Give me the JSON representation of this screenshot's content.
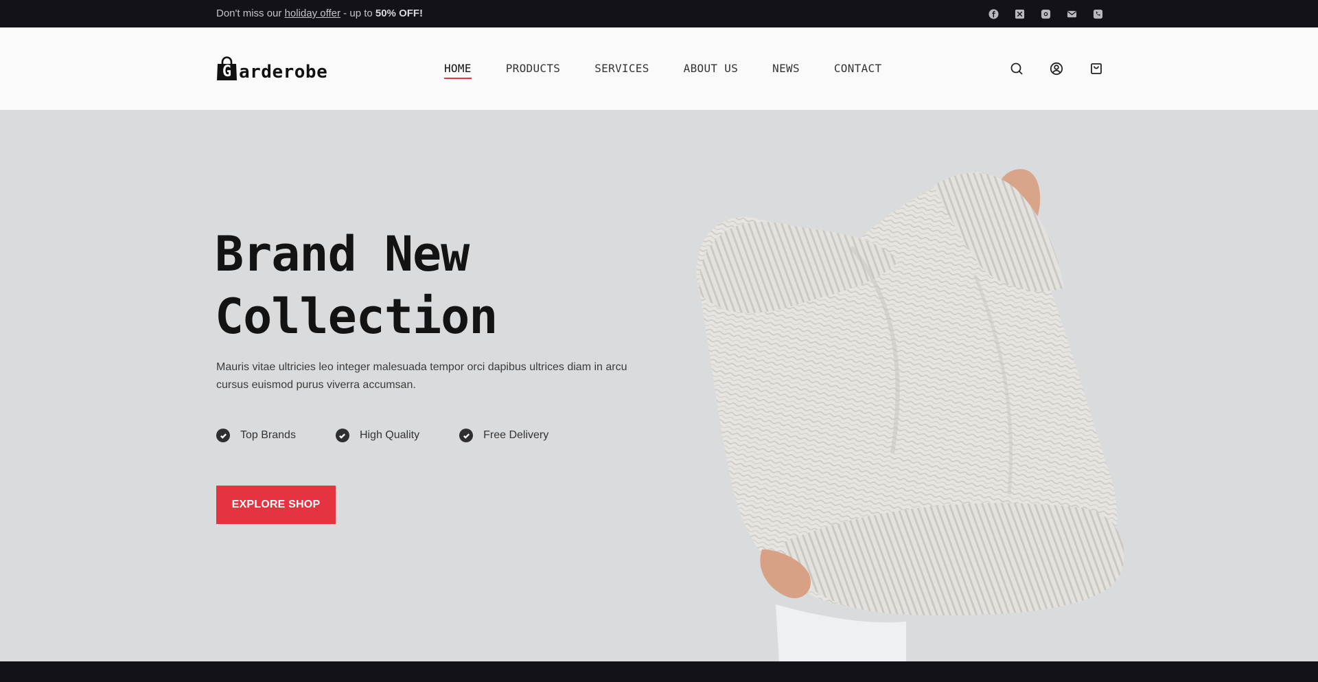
{
  "topbar": {
    "promo_prefix": "Don't miss our ",
    "promo_link": "holiday offer",
    "promo_middle": " - up to ",
    "promo_bold": "50% OFF!",
    "social_icons": [
      "facebook-icon",
      "x-icon",
      "instagram-icon",
      "mail-icon",
      "phone-icon"
    ]
  },
  "header": {
    "logo_letter": "G",
    "logo_text": "arderobe",
    "nav": [
      {
        "label": "HOME",
        "active": true
      },
      {
        "label": "PRODUCTS"
      },
      {
        "label": "SERVICES"
      },
      {
        "label": "ABOUT US"
      },
      {
        "label": "NEWS"
      },
      {
        "label": "CONTACT"
      }
    ],
    "icons": [
      "search-icon",
      "account-icon",
      "cart-icon"
    ]
  },
  "hero": {
    "headline_line1": "Brand New",
    "headline_line2": "Collection",
    "lead": "Mauris vitae ultricies leo integer malesuada tempor orci dapibus ultrices diam in arcu cursus euismod purus viverra accumsan.",
    "features": [
      "Top Brands",
      "High Quality",
      "Free Delivery"
    ],
    "cta": "EXPLORE SHOP"
  },
  "colors": {
    "accent": "#e5343f",
    "dark": "#121218",
    "hero_bg": "#dadbdd"
  }
}
